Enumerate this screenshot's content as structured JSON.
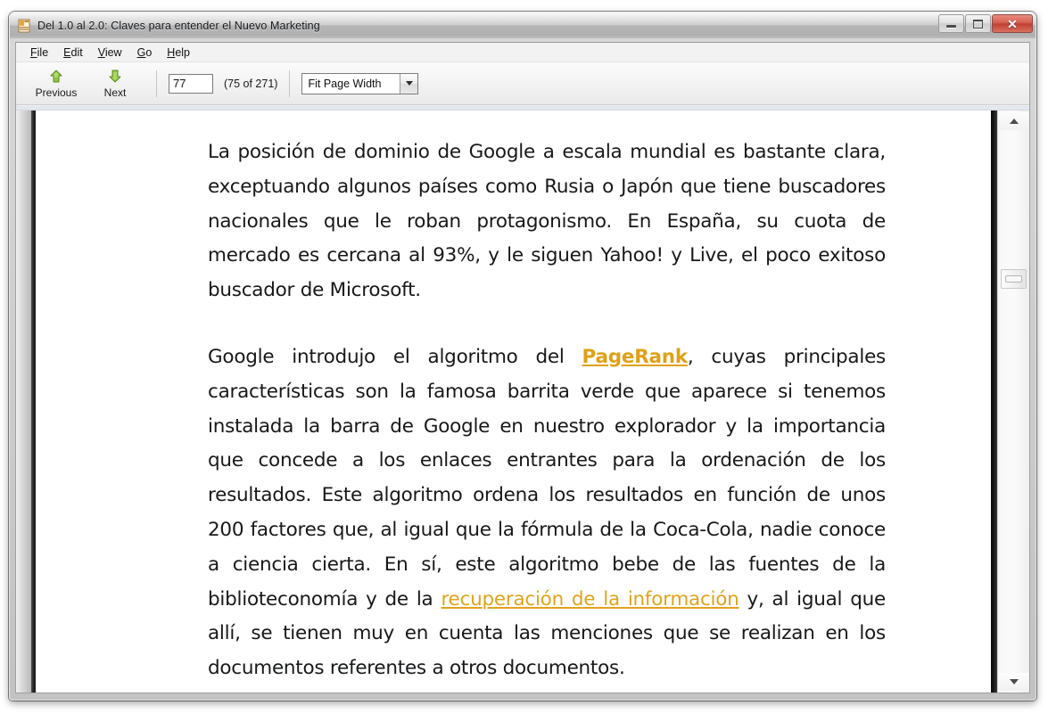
{
  "window": {
    "title": "Del 1.0 al 2.0: Claves para entender el Nuevo Marketing",
    "app_icon": "document-app-icon",
    "controls": {
      "minimize": "minimize-icon",
      "maximize": "maximize-icon",
      "close": "✕"
    }
  },
  "menubar": {
    "items": [
      {
        "label": "File",
        "accel": "F"
      },
      {
        "label": "Edit",
        "accel": "E"
      },
      {
        "label": "View",
        "accel": "V"
      },
      {
        "label": "Go",
        "accel": "G"
      },
      {
        "label": "Help",
        "accel": "H"
      }
    ]
  },
  "toolbar": {
    "previous_label": "Previous",
    "previous_icon": "arrow-up-green-icon",
    "next_label": "Next",
    "next_icon": "arrow-down-green-icon",
    "page_input_value": "77",
    "page_count_label": "(75 of 271)",
    "zoom_value": "Fit Page Width",
    "zoom_caret_icon": "chevron-down-icon"
  },
  "scrollbar": {
    "up_icon": "scroll-up-arrow-icon",
    "down_icon": "scroll-down-arrow-icon",
    "thumb": "scroll-thumb"
  },
  "document": {
    "paragraphs": [
      {
        "id": "par-1",
        "runs": [
          {
            "type": "text",
            "text": "La posición de dominio de Google a escala mundial es bastante clara, exceptuando algunos países como Rusia o Japón que tiene buscadores nacionales que le roban protagonismo. En España, su cuota de mercado es cercana al 93%, y le siguen Yahoo! y Live, el poco exitoso buscador de Microsoft."
          }
        ]
      },
      {
        "id": "par-2",
        "runs": [
          {
            "type": "text",
            "text": "Google introdujo el algoritmo del "
          },
          {
            "type": "link",
            "text": "PageRank",
            "bold": true,
            "color": "#e0a117"
          },
          {
            "type": "text",
            "text": ", cuyas principales características son la famosa barrita verde que aparece si tenemos instalada la barra de Google en nuestro explorador y la importancia que concede a los enlaces entrantes para la ordenación de los resultados. Este algoritmo ordena los resultados en función de unos 200 factores que, al igual que la fórmula de la Coca-Cola, nadie conoce a ciencia cierta. En sí, este algoritmo bebe de las fuentes de la biblioteconomía y de la "
          },
          {
            "type": "link",
            "text": "recuperación de la información",
            "bold": false,
            "color": "#e0a41b"
          },
          {
            "type": "text",
            "text": " y, al igual que allí, se tienen muy en cuenta las menciones que se realizan en los documentos referentes a otros documentos."
          }
        ]
      }
    ]
  },
  "colors": {
    "link": "#e0a41b",
    "link_bold": "#e0a117",
    "titlebar_text": "#15181c",
    "close_button": "#c04033",
    "arrow_green": "#8dc63f",
    "page_background": "#ffffff",
    "viewport_background": "#b5b5b5"
  }
}
